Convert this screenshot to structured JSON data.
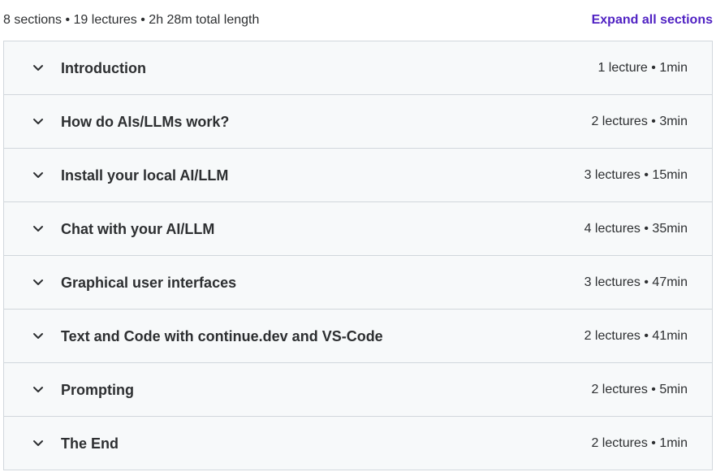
{
  "summary": "8 sections • 19 lectures • 2h 28m total length",
  "expand_all_label": "Expand all sections",
  "colors": {
    "link": "#5022c3",
    "text": "#2d2f31",
    "section_bg": "#f7f9fa",
    "border": "#d1d7dc"
  },
  "sections": [
    {
      "title": "Introduction",
      "meta": "1 lecture • 1min",
      "icon": "chevron-down-icon"
    },
    {
      "title": "How do AIs/LLMs work?",
      "meta": "2 lectures • 3min",
      "icon": "chevron-down-icon"
    },
    {
      "title": "Install your local AI/LLM",
      "meta": "3 lectures • 15min",
      "icon": "chevron-down-icon"
    },
    {
      "title": "Chat with your AI/LLM",
      "meta": "4 lectures • 35min",
      "icon": "chevron-down-icon"
    },
    {
      "title": "Graphical user interfaces",
      "meta": "3 lectures • 47min",
      "icon": "chevron-down-icon"
    },
    {
      "title": "Text and Code with continue.dev and VS-Code",
      "meta": "2 lectures • 41min",
      "icon": "chevron-down-icon"
    },
    {
      "title": "Prompting",
      "meta": "2 lectures • 5min",
      "icon": "chevron-down-icon"
    },
    {
      "title": "The End",
      "meta": "2 lectures • 1min",
      "icon": "chevron-down-icon"
    }
  ]
}
